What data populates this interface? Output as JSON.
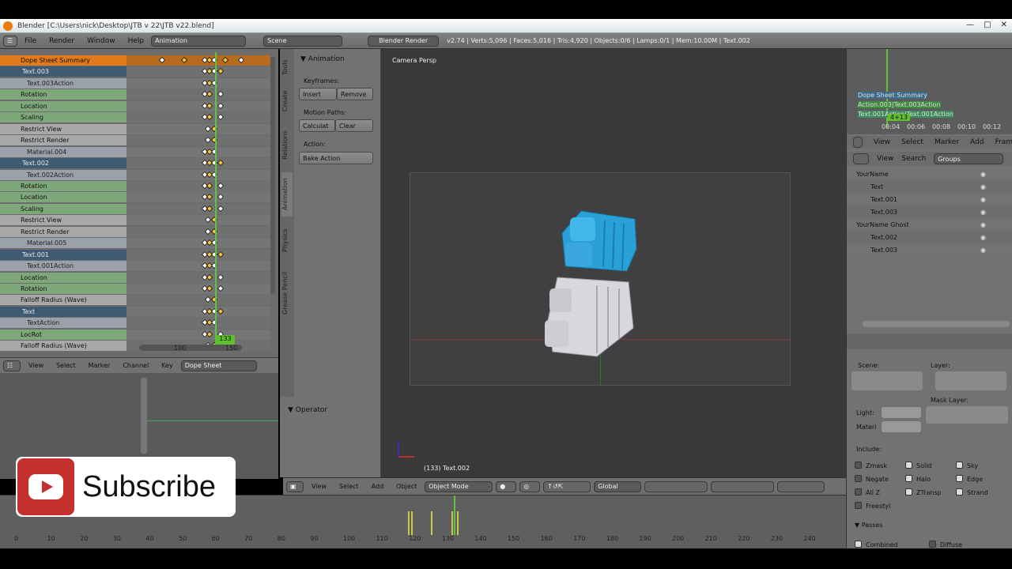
{
  "window": {
    "title": "Blender [C:\\Users\\nick\\Desktop\\JTB v 22\\JTB v22.blend]"
  },
  "infobar": {
    "menus": [
      "File",
      "Render",
      "Window",
      "Help"
    ],
    "screen": "Animation",
    "scene": "Scene",
    "engine": "Blender Render",
    "stats": "v2.74 | Verts:5,096 | Faces:5,016 | Tris:4,920 | Objects:0/6 | Lamps:0/1 | Mem:10.00M | Text.002"
  },
  "dopesheet": {
    "channels": [
      {
        "label": "Dope Sheet Summary",
        "kind": "sum"
      },
      {
        "label": "Text.003",
        "kind": "obj"
      },
      {
        "label": "Text.003Action",
        "kind": "act"
      },
      {
        "label": "Rotation",
        "kind": "green"
      },
      {
        "label": "Location",
        "kind": "green"
      },
      {
        "label": "Scaling",
        "kind": "green"
      },
      {
        "label": "Restrict View",
        "kind": "grey"
      },
      {
        "label": "Restrict Render",
        "kind": "grey"
      },
      {
        "label": "Material.004",
        "kind": "act"
      },
      {
        "label": "Text.002",
        "kind": "obj"
      },
      {
        "label": "Text.002Action",
        "kind": "act"
      },
      {
        "label": "Rotation",
        "kind": "green"
      },
      {
        "label": "Location",
        "kind": "green"
      },
      {
        "label": "Scaling",
        "kind": "green"
      },
      {
        "label": "Restrict View",
        "kind": "grey"
      },
      {
        "label": "Restrict Render",
        "kind": "grey"
      },
      {
        "label": "Material.005",
        "kind": "act"
      },
      {
        "label": "Text.001",
        "kind": "obj"
      },
      {
        "label": "Text.001Action",
        "kind": "act"
      },
      {
        "label": "Location",
        "kind": "green"
      },
      {
        "label": "Rotation",
        "kind": "green"
      },
      {
        "label": "Falloff Radius (Wave)",
        "kind": "grey"
      },
      {
        "label": "Text",
        "kind": "obj"
      },
      {
        "label": "TextAction",
        "kind": "act"
      },
      {
        "label": "LocRot",
        "kind": "green"
      },
      {
        "label": "Falloff Radius (Wave)",
        "kind": "grey"
      }
    ],
    "current_frame": "133",
    "ruler": [
      "100",
      "150"
    ],
    "header": [
      "View",
      "Select",
      "Marker",
      "Channel",
      "Key"
    ],
    "mode": "Dope Sheet"
  },
  "toolshelf": {
    "panel": "Animation",
    "keyframes_label": "Keyframes:",
    "insert": "Insert",
    "remove": "Remove",
    "motion_paths_label": "Motion Paths:",
    "calculate": "Calculat",
    "clear": "Clear",
    "action_label": "Action:",
    "bake": "Bake Action",
    "operator": "Operator",
    "tabs": [
      "Tools",
      "Create",
      "Relations",
      "Animation",
      "Physics",
      "Grease Pencil"
    ]
  },
  "viewport": {
    "view_label": "Camera Persp",
    "object_label": "(133) Text.002",
    "header": [
      "View",
      "Select",
      "Add",
      "Object"
    ],
    "mode": "Object Mode",
    "orientation": "Global"
  },
  "timeline": {
    "ticks": [
      "0",
      "10",
      "20",
      "30",
      "40",
      "50",
      "60",
      "70",
      "80",
      "90",
      "100",
      "110",
      "120",
      "130",
      "140",
      "150",
      "160",
      "170",
      "180",
      "190",
      "200",
      "210",
      "220",
      "230",
      "240"
    ]
  },
  "graph_mini": {
    "rows": [
      "Dope Sheet Summary",
      "Action.003|Text.003Action",
      "Text.001Action|Text.001Action"
    ],
    "frame": "4+13",
    "ticks": [
      "00:04",
      "00:06",
      "00:08",
      "00:10",
      "00:12"
    ],
    "header": [
      "View",
      "Select",
      "Marker",
      "Add",
      "Fram"
    ]
  },
  "outliner": {
    "header": [
      "View",
      "Search"
    ],
    "display": "Groups",
    "rows": [
      {
        "label": "YourName",
        "indent": 0
      },
      {
        "label": "Text",
        "indent": 1
      },
      {
        "label": "Text.001",
        "indent": 1
      },
      {
        "label": "Text.003",
        "indent": 1
      },
      {
        "label": "YourName Ghost",
        "indent": 0
      },
      {
        "label": "Text.002",
        "indent": 1
      },
      {
        "label": "Text.003",
        "indent": 1
      }
    ]
  },
  "properties": {
    "scene_label": "Scene:",
    "layer_label": "Layer:",
    "mask_layer_label": "Mask Layer:",
    "light": "Light:",
    "material": "Materi",
    "include": "Include:",
    "options": [
      {
        "label": "Zmask",
        "on": false
      },
      {
        "label": "Solid",
        "on": true
      },
      {
        "label": "Sky",
        "on": true
      },
      {
        "label": "Negate",
        "on": false
      },
      {
        "label": "Halo",
        "on": true
      },
      {
        "label": "Edge",
        "on": true
      },
      {
        "label": "All Z",
        "on": false
      },
      {
        "label": "ZTransp",
        "on": true
      },
      {
        "label": "Strand",
        "on": true
      },
      {
        "label": "Freestyl",
        "on": false
      }
    ],
    "passes": "Passes",
    "combined": "Combined",
    "diffuse": "Diffuse"
  },
  "overlay": {
    "subscribe": "Subscribe"
  },
  "colors": {
    "accent": "#e07a1a",
    "current_frame": "#5fbf2c",
    "logo_blue": "#2aa0d8",
    "logo_white": "#d8d8dc"
  }
}
